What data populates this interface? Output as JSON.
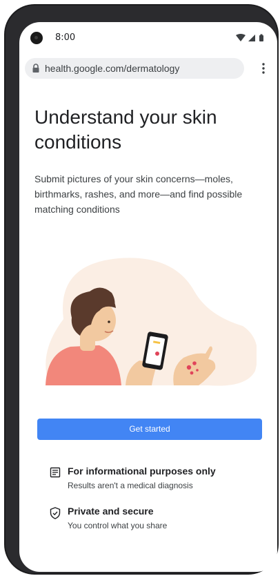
{
  "status_bar": {
    "time": "8:00",
    "icons": [
      "wifi-icon",
      "signal-icon",
      "battery-icon"
    ]
  },
  "browser": {
    "url": "health.google.com/dermatology",
    "lock_icon": "lock-icon",
    "menu_icon": "more-vert-icon"
  },
  "page": {
    "headline": "Understand your skin conditions",
    "description": "Submit pictures of your skin concerns—moles, birthmarks, rashes, and more—and find possible matching conditions",
    "cta_label": "Get started",
    "features": [
      {
        "icon": "document-icon",
        "title": "For informational purposes only",
        "subtitle": "Results aren't a medical diagnosis"
      },
      {
        "icon": "shield-check-icon",
        "title": "Private and secure",
        "subtitle": "You control what you share"
      }
    ]
  },
  "colors": {
    "accent": "#4285f4",
    "illustration_bg": "#fbeee4",
    "skin": "#f2c9a0",
    "shirt": "#f2877b",
    "hair": "#5a3a2c",
    "rash": "#e0445a"
  }
}
